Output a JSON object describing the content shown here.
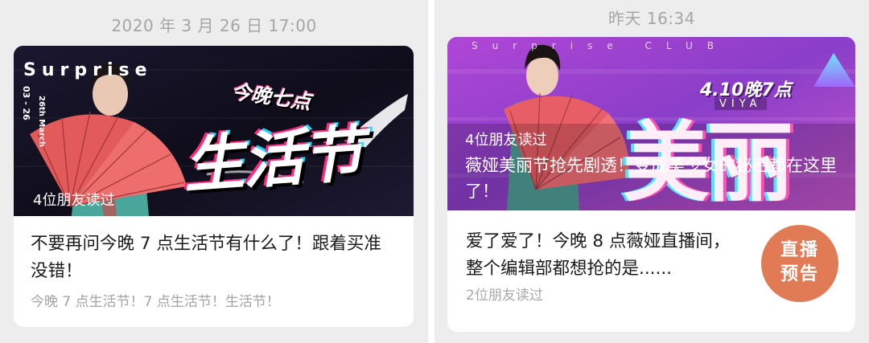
{
  "left": {
    "timestamp": "2020 年 3 月 26 日 17:00",
    "cover": {
      "brand": "Surprise",
      "date_en": "26th March",
      "date_num": "03 - 26",
      "headline_small": "今晚七点",
      "headline_big": "生活节",
      "read_count": "4位朋友读过"
    },
    "title": "不要再问今晚 7 点生活节有什么了！跟着买准没错！",
    "digest": "今晚 7 点生活节！7 点生活节！生活节！"
  },
  "right": {
    "timestamp": "昨天 16:34",
    "cover": {
      "brand": "Surprise CLUB",
      "date": "4.10晚7点",
      "sub": "VIYA",
      "headline_big": "美丽节",
      "read_count": "4位朋友读过",
      "overlay_title": "薇娅美丽节抢先剧透！变成美少女的秘密都在这里了！"
    },
    "title": "爱了爱了！今晚 8 点薇娅直播间，整个编辑部都想抢的是......",
    "read_count": "2位朋友读过",
    "badge": {
      "line1": "直播",
      "line2": "预告",
      "color": "#e07b56"
    }
  }
}
